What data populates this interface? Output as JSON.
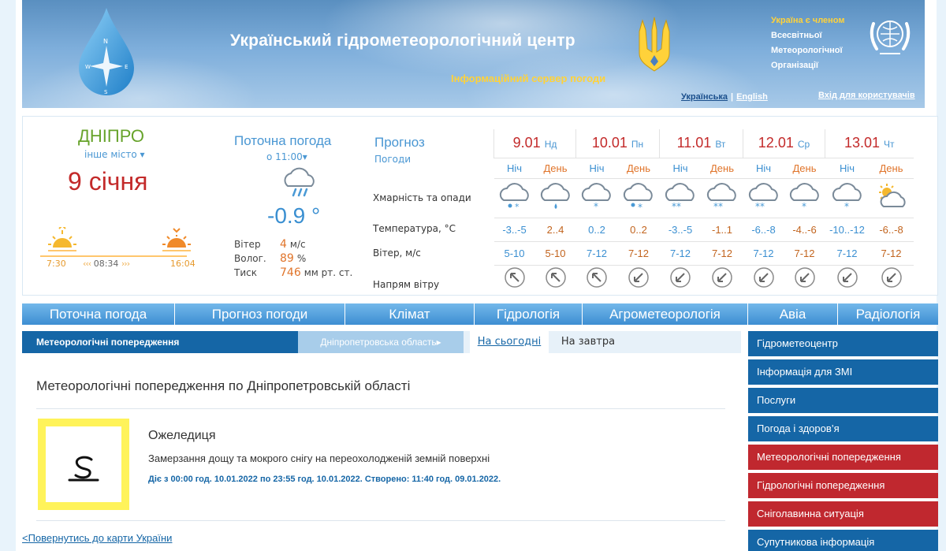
{
  "header": {
    "title": "Український гідрометеорологічний центр",
    "subtitle": "Інформаційний сервер погоди",
    "wmo_lines": [
      "Україна є членом",
      "Всесвітньої",
      "Метеорологічної",
      "Організації"
    ],
    "lang_ua": "Українська",
    "lang_en": "English",
    "login": "Вхід для користувачів"
  },
  "location": {
    "city": "ДНІПРО",
    "other_city": "інше місто",
    "date": "9 січня",
    "sunrise": "7:30",
    "day_length": "08:34",
    "sunset": "16:04"
  },
  "current": {
    "title": "Поточна погода",
    "time": "о 11:00",
    "temp": "-0.9 °",
    "wind_label": "Вітер",
    "wind_value": "4",
    "wind_unit": "м/с",
    "humidity_label": "Волог.",
    "humidity_value": "89",
    "humidity_unit": "%",
    "pressure_label": "Тиск",
    "pressure_value": "746",
    "pressure_unit": "мм рт. ст."
  },
  "forecast": {
    "title": "Прогноз",
    "subtitle": "Погоди",
    "row_labels": [
      "Хмарність та опади",
      "Температура, °C",
      "Вітер, м/с",
      "Напрям вітру"
    ],
    "night_label": "Ніч",
    "day_label": "День",
    "days": [
      {
        "date": "9.01",
        "dow": "Нд",
        "temp_n": "-3..-5",
        "temp_d": "2..4",
        "wind_n": "5-10",
        "wind_d": "5-10"
      },
      {
        "date": "10.01",
        "dow": "Пн",
        "temp_n": "0..2",
        "temp_d": "0..2",
        "wind_n": "7-12",
        "wind_d": "7-12"
      },
      {
        "date": "11.01",
        "dow": "Вт",
        "temp_n": "-3..-5",
        "temp_d": "-1..1",
        "wind_n": "7-12",
        "wind_d": "7-12"
      },
      {
        "date": "12.01",
        "dow": "Ср",
        "temp_n": "-6..-8",
        "temp_d": "-4..-6",
        "wind_n": "7-12",
        "wind_d": "7-12"
      },
      {
        "date": "13.01",
        "dow": "Чт",
        "temp_n": "-10..-12",
        "temp_d": "-6..-8",
        "wind_n": "7-12",
        "wind_d": "7-12"
      }
    ]
  },
  "nav": [
    "Поточна погода",
    "Прогноз погоди",
    "Клімат",
    "Гідрологія",
    "Агрометеорологія",
    "Авіа",
    "Радіологія"
  ],
  "subtabs": {
    "active": "Метеорологічні попередження",
    "region": "Дніпропетровська область",
    "today": "На сьогодні",
    "tomorrow": "На завтра"
  },
  "warning": {
    "heading": "Метеорологічні попередження по Дніпропетровській області",
    "name": "Ожеледиця",
    "description": "Замерзання дощу та мокрого снігу на переохолодженій земній поверхні",
    "period": "Діє з 00:00 год. 10.01.2022 по 23:55 год. 10.01.2022. Створено: 11:40 год. 09.01.2022."
  },
  "back_link": "<Повернутись до карти України",
  "side_menu": [
    {
      "label": "Гідрометеоцентр",
      "color": "#1566a6"
    },
    {
      "label": "Інформація для ЗМІ",
      "color": "#1566a6"
    },
    {
      "label": "Послуги",
      "color": "#1566a6"
    },
    {
      "label": "Погода і здоров’я",
      "color": "#1566a6"
    },
    {
      "label": "Метеорологічні попередження",
      "color": "#c0282f"
    },
    {
      "label": "Гідрологічні попередження",
      "color": "#c0282f"
    },
    {
      "label": "Сніголавинна ситуація",
      "color": "#c0282f"
    },
    {
      "label": "Супутникова інформація",
      "color": "#1566a6"
    }
  ]
}
